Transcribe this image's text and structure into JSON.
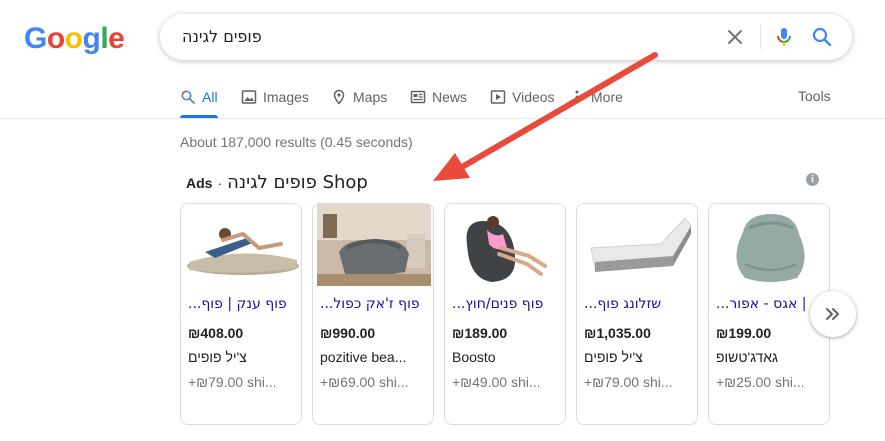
{
  "logo": {
    "G": "G",
    "o1": "o",
    "o2": "o",
    "g": "g",
    "l": "l",
    "e": "e"
  },
  "search": {
    "query": "פופים לגינה"
  },
  "icons": {
    "clear": "close-icon",
    "mic": "mic-icon",
    "search": "search-icon",
    "info": "info-icon",
    "next": "chevron-double-right-icon"
  },
  "tabs": [
    {
      "label": "All",
      "icon": "search-icon",
      "active": true
    },
    {
      "label": "Images",
      "icon": "image-icon"
    },
    {
      "label": "Maps",
      "icon": "map-pin-icon"
    },
    {
      "label": "News",
      "icon": "news-icon"
    },
    {
      "label": "Videos",
      "icon": "video-icon"
    },
    {
      "label": "More",
      "icon": "more-icon"
    }
  ],
  "tools_label": "Tools",
  "stats": "About 187,000 results (0.45 seconds)",
  "shop": {
    "ads_label": "Ads",
    "separator": "·",
    "title": "פופים לגינה Shop",
    "info_symbol": "i"
  },
  "products": [
    {
      "title": "פוף ענק | פוף...",
      "price": "₪408.00",
      "store": "צ'יל פופים",
      "shipping": "+₪79.00 shi..."
    },
    {
      "title": "פוף ז'אק כפול...",
      "price": "₪990.00",
      "store": "pozitive bea...",
      "shipping": "+₪69.00 shi..."
    },
    {
      "title": "פוף פנים/חוץ...",
      "price": "₪189.00",
      "store": "Boosto",
      "shipping": "+₪49.00 shi..."
    },
    {
      "title": "שזלונג פוף...",
      "price": "₪1,035.00",
      "store": "צ'יל פופים",
      "shipping": "+₪79.00 shi..."
    },
    {
      "title": "| אגס - אפור...",
      "price": "₪199.00",
      "store": "גאדג'טשופ",
      "shipping": "+₪25.00 shi..."
    }
  ],
  "colors": {
    "link": "#1a0dab",
    "accent": "#1a73e8",
    "annotation": "#ea4335"
  }
}
